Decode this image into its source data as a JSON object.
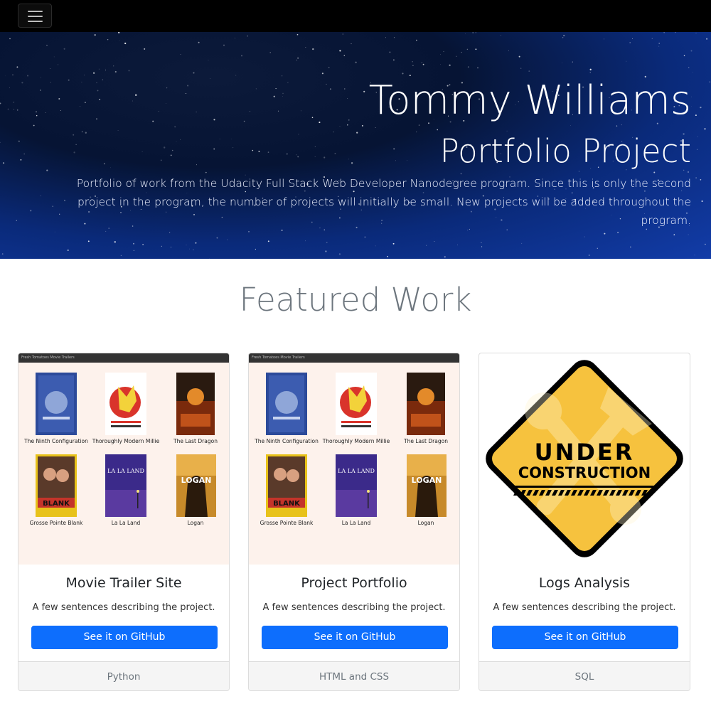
{
  "navbar": {
    "toggle_icon": "hamburger-icon"
  },
  "hero": {
    "title": "Tommy Williams",
    "subtitle": "Portfolio Project",
    "description": "Portfolio of work from the Udacity Full Stack Web Developer Nanodegree program. Since this is only the second project in the program, the number of projects will initially be small. New projects will be added throughout the program."
  },
  "section": {
    "title": "Featured Work"
  },
  "mini_site": {
    "bar_title": "Fresh Tomatoes Movie Trailers",
    "movies": [
      "The Ninth Configuration",
      "Thoroughly Modern Millie",
      "The Last Dragon",
      "Grosse Pointe Blank",
      "La La Land",
      "Logan"
    ],
    "poster_texts": {
      "grosse": "BLANK",
      "lalaland": "LA LA LAND",
      "logan": "LOGAN"
    }
  },
  "cards": [
    {
      "title": "Movie Trailer Site",
      "text": "A few sentences describing the project.",
      "button": "See it on GitHub",
      "footer": "Python"
    },
    {
      "title": "Project Portfolio",
      "text": "A few sentences describing the project.",
      "button": "See it on GitHub",
      "footer": "HTML and CSS"
    },
    {
      "title": "Logs Analysis",
      "text": "A few sentences describing the project.",
      "button": "See it on GitHub",
      "footer": "SQL"
    }
  ],
  "construction": {
    "line1": "UNDER",
    "line2": "CONSTRUCTION"
  },
  "colors": {
    "primary_button": "#0d6efd",
    "navbar": "#000000",
    "sign_yellow": "#f6c23e"
  }
}
